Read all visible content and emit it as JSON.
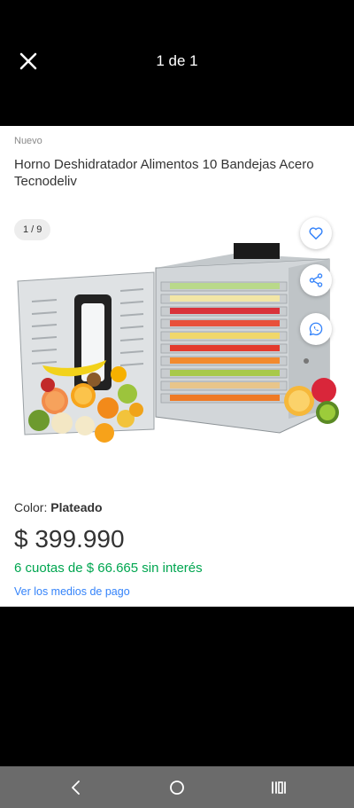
{
  "header": {
    "close_icon": "close-icon",
    "pager_text": "1 de 1"
  },
  "product": {
    "condition": "Nuevo",
    "title": "Horno Deshidratador Alimentos 10 Bandejas Acero Tecnodeliv",
    "image_counter": "1 / 9",
    "color_label": "Color: ",
    "color_value": "Plateado",
    "price": "$ 399.990",
    "installments": "6 cuotas de $ 66.665 sin interés",
    "payment_link": "Ver los medios de pago"
  },
  "actions": {
    "favorite_icon": "heart-icon",
    "share_icon": "share-icon",
    "whatsapp_icon": "whatsapp-icon"
  },
  "navbar": {
    "back_icon": "back-icon",
    "home_icon": "home-icon",
    "recents_icon": "recents-icon"
  },
  "colors": {
    "price_green": "#00a650",
    "link_blue": "#3483fa",
    "text_dark": "#333333",
    "navbar_gray": "#6b6b6b"
  }
}
